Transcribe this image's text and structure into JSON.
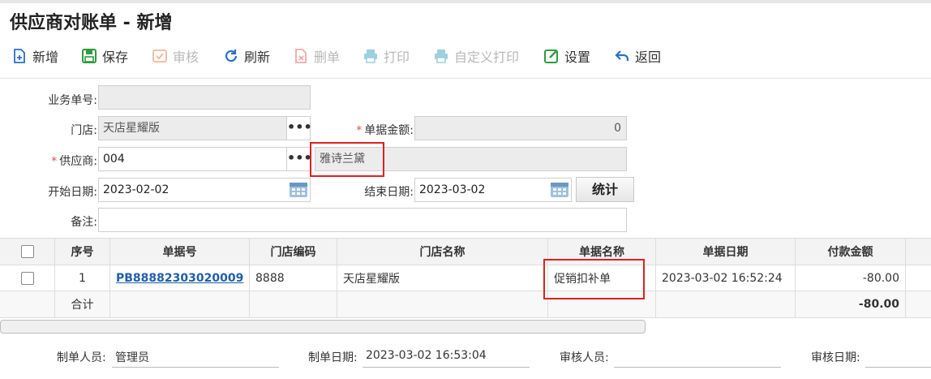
{
  "window_title": "供应商对账单 - 新增",
  "toolbar": [
    {
      "label": "新增",
      "icon": "add-document-icon",
      "enabled": true
    },
    {
      "label": "保存",
      "icon": "save-icon",
      "enabled": true
    },
    {
      "label": "审核",
      "icon": "audit-check-icon",
      "enabled": false
    },
    {
      "label": "刷新",
      "icon": "refresh-icon",
      "enabled": true
    },
    {
      "label": "删单",
      "icon": "delete-document-icon",
      "enabled": false
    },
    {
      "label": "打印",
      "icon": "printer-icon",
      "enabled": false
    },
    {
      "label": "自定义打印",
      "icon": "printer-icon",
      "enabled": false
    },
    {
      "label": "设置",
      "icon": "edit-settings-icon",
      "enabled": true
    },
    {
      "label": "返回",
      "icon": "back-arrow-icon",
      "enabled": true
    }
  ],
  "form": {
    "biz_no_label": "业务单号:",
    "biz_no_value": "",
    "store_label": "门店:",
    "store_value": "天店星耀版",
    "amount_label": "单据金额:",
    "amount_value": "0",
    "supplier_label": "供应商:",
    "supplier_code": "004",
    "supplier_name": "雅诗兰黛",
    "start_date_label": "开始日期:",
    "start_date": "2023-02-02",
    "end_date_label": "结束日期:",
    "end_date": "2023-03-02",
    "stat_button": "统计",
    "remark_label": "备注:",
    "remark_value": "",
    "more_glyph": "•••"
  },
  "table": {
    "headers": [
      "序号",
      "单据号",
      "门店编码",
      "门店名称",
      "单据名称",
      "单据日期",
      "付款金额"
    ],
    "rows": [
      {
        "index": "1",
        "doc_no": "PB88882303020009",
        "store_code": "8888",
        "store_name": "天店星耀版",
        "doc_name": "促销扣补单",
        "doc_date": "2023-03-02 16:52:24",
        "amount": "-80.00"
      }
    ],
    "total_label": "合计",
    "total_amount": "-80.00"
  },
  "footer": {
    "creator_label": "制单人员:",
    "creator_value": "管理员",
    "create_date_label": "制单日期:",
    "create_date_value": "2023-03-02 16:53:04",
    "auditor_label": "审核人员:",
    "auditor_value": "",
    "audit_date_label": "审核日期:",
    "audit_date_value": ""
  },
  "colors": {
    "highlight_box": "#e02020",
    "link": "#1f5fa8",
    "required": "#d9534f"
  }
}
